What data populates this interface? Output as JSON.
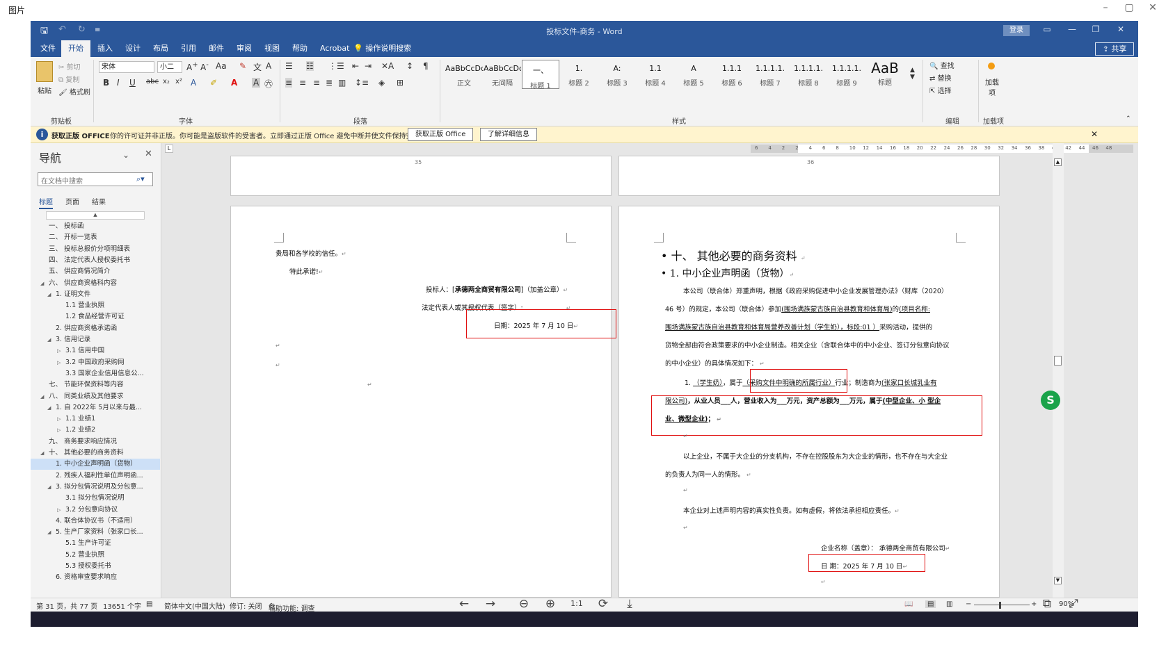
{
  "viewer": {
    "title": "图片"
  },
  "word": {
    "title": "投标文件-商务 - Word",
    "login": "登录",
    "share": "共享",
    "menu": [
      "文件",
      "开始",
      "插入",
      "设计",
      "布局",
      "引用",
      "邮件",
      "审阅",
      "视图",
      "帮助",
      "Acrobat",
      "操作说明搜索"
    ],
    "clipboard": {
      "paste": "粘贴",
      "cut": "剪切",
      "copy": "复制",
      "format_painter": "格式刷",
      "label": "剪贴板"
    },
    "font": {
      "name": "宋体",
      "size": "小二",
      "label": "字体"
    },
    "paragraph": {
      "label": "段落"
    },
    "styles": {
      "label": "样式",
      "items": [
        {
          "sample": "AaBbCcDdI",
          "name": "正文"
        },
        {
          "sample": "AaBbCcDdI",
          "name": "无间隔"
        },
        {
          "sample": "一、",
          "name": "标题 1"
        },
        {
          "sample": "1.",
          "name": "标题 2"
        },
        {
          "sample": "A:",
          "name": "标题 3"
        },
        {
          "sample": "1.1",
          "name": "标题 4"
        },
        {
          "sample": "A",
          "name": "标题 5"
        },
        {
          "sample": "1.1.1",
          "name": "标题 6"
        },
        {
          "sample": "1.1.1.1.",
          "name": "标题 7"
        },
        {
          "sample": "1.1.1.1.",
          "name": "标题 8"
        },
        {
          "sample": "1.1.1.1.",
          "name": "标题 9"
        },
        {
          "sample": "AaB",
          "name": "标题"
        }
      ]
    },
    "editing": {
      "find": "查找",
      "replace": "替换",
      "select": "选择",
      "label": "编辑"
    },
    "addins": {
      "load": "加载项",
      "label": "加载项"
    },
    "warning": {
      "title": "获取正版 OFFICE",
      "message": "你的许可证并非正版。你可能是盗版软件的受害者。立即通过正版 Office 避免中断并使文件保持安全。",
      "btn1": "获取正版 Office",
      "btn2": "了解详细信息"
    },
    "nav": {
      "title": "导航",
      "search_placeholder": "在文档中搜索",
      "tabs": [
        "标题",
        "页面",
        "结果"
      ],
      "items": [
        {
          "text": "一、 投标函",
          "level": 0,
          "arrow": ""
        },
        {
          "text": "二、 开标一览表",
          "level": 0,
          "arrow": ""
        },
        {
          "text": "三、 投标总报价分项明细表",
          "level": 0,
          "arrow": ""
        },
        {
          "text": "四、 法定代表人授权委托书",
          "level": 0,
          "arrow": ""
        },
        {
          "text": "五、 供应商情况简介",
          "level": 0,
          "arrow": ""
        },
        {
          "text": "六、 供应商资格科内容",
          "level": 0,
          "arrow": "▲"
        },
        {
          "text": "1. 证明文件",
          "level": 1,
          "arrow": "▲"
        },
        {
          "text": "1.1 营业执照",
          "level": 2,
          "arrow": ""
        },
        {
          "text": "1.2 食品经营许可证",
          "level": 2,
          "arrow": ""
        },
        {
          "text": "2. 供应商资格承诺函",
          "level": 1,
          "arrow": ""
        },
        {
          "text": "3. 信用记录",
          "level": 1,
          "arrow": "▲"
        },
        {
          "text": "3.1 信用中国",
          "level": 2,
          "arrow": "▷"
        },
        {
          "text": "3.2 中国政府采购网",
          "level": 2,
          "arrow": "▷"
        },
        {
          "text": "3.3 国家企业信用信息公...",
          "level": 2,
          "arrow": ""
        },
        {
          "text": "七、 节能环保资料等内容",
          "level": 0,
          "arrow": ""
        },
        {
          "text": "八、 同类业绩及其他要求",
          "level": 0,
          "arrow": "▲"
        },
        {
          "text": "1. 自 2022年 5月以来与最...",
          "level": 1,
          "arrow": "▲"
        },
        {
          "text": "1.1 业绩1",
          "level": 2,
          "arrow": "▷"
        },
        {
          "text": "1.2 业绩2",
          "level": 2,
          "arrow": "▷"
        },
        {
          "text": "九、 商务要求响应情况",
          "level": 0,
          "arrow": ""
        },
        {
          "text": "十、 其他必要的商务资料",
          "level": 0,
          "arrow": "▲"
        },
        {
          "text": "1. 中小企业声明函（货物）",
          "level": 1,
          "arrow": "",
          "selected": true
        },
        {
          "text": "2. 残疾人福利性单位声明函...",
          "level": 1,
          "arrow": ""
        },
        {
          "text": "3. 拟分包情况说明及分包意...",
          "level": 1,
          "arrow": "▲"
        },
        {
          "text": "3.1 拟分包情况说明",
          "level": 2,
          "arrow": ""
        },
        {
          "text": "3.2 分包意向协议",
          "level": 2,
          "arrow": "▷"
        },
        {
          "text": "4. 联合体协议书（不适用）",
          "level": 1,
          "arrow": ""
        },
        {
          "text": "5. 生产厂家资料（张家口长...",
          "level": 1,
          "arrow": "▲"
        },
        {
          "text": "5.1 生产许可证",
          "level": 2,
          "arrow": ""
        },
        {
          "text": "5.2 营业执照",
          "level": 2,
          "arrow": ""
        },
        {
          "text": "5.3 授权委托书",
          "level": 2,
          "arrow": ""
        },
        {
          "text": "6. 资格审查要求响应",
          "level": 1,
          "arrow": ""
        }
      ]
    },
    "ruler": [
      "6",
      "4",
      "2",
      "2",
      "4",
      "6",
      "8",
      "10",
      "12",
      "14",
      "16",
      "18",
      "20",
      "22",
      "24",
      "26",
      "28",
      "30",
      "32",
      "34",
      "36",
      "38",
      "40",
      "42",
      "44",
      "46",
      "48"
    ],
    "pages": {
      "left_top_num": "35",
      "right_top_num": "36",
      "left": {
        "line1": "贵局和各学校的信任。",
        "line2": "特此承诺!",
        "bidder_prefix": "投标人：[",
        "bidder_name": "承德两全商贸有限公司",
        "bidder_suffix": "]（加盖公章）",
        "legal_rep": "法定代表人或其授权代表（签字）:",
        "date": "日期：2025 年 7 月 10 日"
      },
      "right": {
        "heading1": "十、 其他必要的商务资料",
        "heading2": "1. 中小企业声明函（货物）",
        "p1a": "本公司（联合体）郑重声明，根据《政府采购促进中小企业发展管理办法》（财库（2020）",
        "p1b_pre": "46 号）的规定，本公司（联合体）参加",
        "p1b_u1": "(围场满族蒙古族自治县教育和体育局)",
        "p1b_mid": "的",
        "p1b_u2": "(项目名称:",
        "p1c_u": "围场满族蒙古族自治县教育和体育局营养改善计划（学生奶），标段:01 ）",
        "p1c_post": "采购活动，提供的",
        "p1d": "货物全部由符合政策要求的中小企业制造。相关企业（含联合体中的中小企业、签订分包意向协议",
        "p1e": "的中小企业）的具体情况如下：",
        "item_num": "1.",
        "item_product": "（学生奶）",
        "item_mid": "，属于",
        "item_industry": "（采购文件中明确的所属行业）",
        "item_post": "行业；制造商为",
        "item_maker1": "(张家口长城乳业有",
        "item_maker2": "限公司)",
        "item_bold1": "，从业人员___人，营业收入为___万元，资产总额为___万元，属于",
        "item_bold1_u": "(中型企业、小 型企",
        "item_bold2_u": "业、微型企业)",
        "item_bold2_end": "；",
        "p2a": "以上企业，不属于大企业的分支机构，不存在控股股东为大企业的情形，也不存在与大企业",
        "p2b": "的负责人为同一人的情形。",
        "p3": "本企业对上述声明内容的真实性负责。如有虚假，将依法承担相应责任。",
        "company": "企业名称（盖章）：  承德两全商贸有限公司",
        "date": "日  期：2025 年 7 月 10 日"
      }
    },
    "status": {
      "page": "第 31 页，共 77 页",
      "words": "13651 个字",
      "lang": "简体中文(中国大陆)",
      "track": "修订: 关闭",
      "access": "辅助功能: 调查",
      "zoom": "90%"
    }
  }
}
